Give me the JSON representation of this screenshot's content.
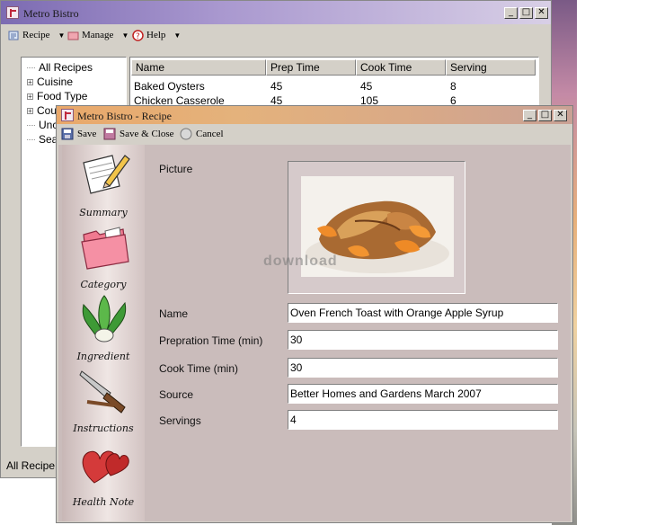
{
  "main_window": {
    "title": "Metro Bistro",
    "toolbar": {
      "recipe": "Recipe",
      "manage": "Manage",
      "help": "Help"
    },
    "tree": [
      "All Recipes",
      "Cuisine",
      "Food Type",
      "Cou",
      "Unc",
      "Sea"
    ],
    "list": {
      "columns": [
        "Name",
        "Prep Time",
        "Cook Time",
        "Serving"
      ],
      "rows": [
        [
          "Baked Oysters",
          "45",
          "45",
          "8"
        ],
        [
          "Chicken Casserole",
          "45",
          "105",
          "6"
        ]
      ]
    },
    "status": "All Recipe"
  },
  "recipe_window": {
    "title": "Metro Bistro - Recipe",
    "toolbar": {
      "save": "Save",
      "save_close": "Save & Close",
      "cancel": "Cancel"
    },
    "nav": [
      "Summary",
      "Category",
      "Ingredient",
      "Instructions",
      "Health Note"
    ],
    "fields": {
      "picture_label": "Picture",
      "name_label": "Name",
      "name_value": "Oven French Toast with Orange Apple Syrup",
      "prep_label": "Prepration Time (min)",
      "prep_value": "30",
      "cook_label": "Cook Time (min)",
      "cook_value": "30",
      "source_label": "Source",
      "source_value": "Better Homes and Gardens March 2007",
      "servings_label": "Servings",
      "servings_value": "4"
    },
    "watermark": "download"
  },
  "window_buttons": {
    "minimize": "_",
    "maximize": "□",
    "close": "✕"
  },
  "icons": [
    "app-icon",
    "recipe-icon",
    "manage-icon",
    "help-icon",
    "save-icon",
    "save-close-icon",
    "cancel-icon",
    "pencil-paper-icon",
    "folder-icon",
    "bok-choy-icon",
    "knife-icon",
    "heart-icon"
  ]
}
